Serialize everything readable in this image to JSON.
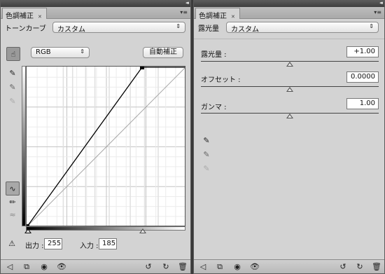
{
  "left": {
    "tab_title": "色調補正",
    "preset_label": "トーンカーブ",
    "preset_value": "カスタム",
    "channel_value": "RGB",
    "auto_button": "自動補正",
    "output_label": "出力 :",
    "output_value": "255",
    "input_label": "入力 :",
    "input_value": "185",
    "curve": {
      "points": [
        [
          0,
          0
        ],
        [
          185,
          255
        ],
        [
          255,
          255
        ]
      ],
      "histogram_lines": [
        58,
        73,
        94,
        109,
        132,
        166,
        189,
        211
      ]
    }
  },
  "right": {
    "tab_title": "色調補正",
    "preset_label": "露光量",
    "preset_value": "カスタム",
    "exposure_label": "露光量 :",
    "exposure_value": "+1.00",
    "exposure_slider": 0.5,
    "offset_label": "オフセット :",
    "offset_value": "0.0000",
    "offset_slider": 0.5,
    "gamma_label": "ガンマ :",
    "gamma_value": "1.00",
    "gamma_slider": 0.5
  },
  "icons": {
    "collapse": "◂◂",
    "menu": "▾≡",
    "tab_close": "✕",
    "select_arrow": "⇕",
    "hand_tool": "☝",
    "eyedropper": "✎",
    "curve_tool": "∿",
    "pencil": "✏",
    "smooth": "≈",
    "warning": "⚠",
    "back": "◁",
    "clip": "⧉",
    "circle": "◉",
    "eye": "👁",
    "reset_prev": "↺",
    "reset": "↻",
    "trash": "🗑"
  }
}
